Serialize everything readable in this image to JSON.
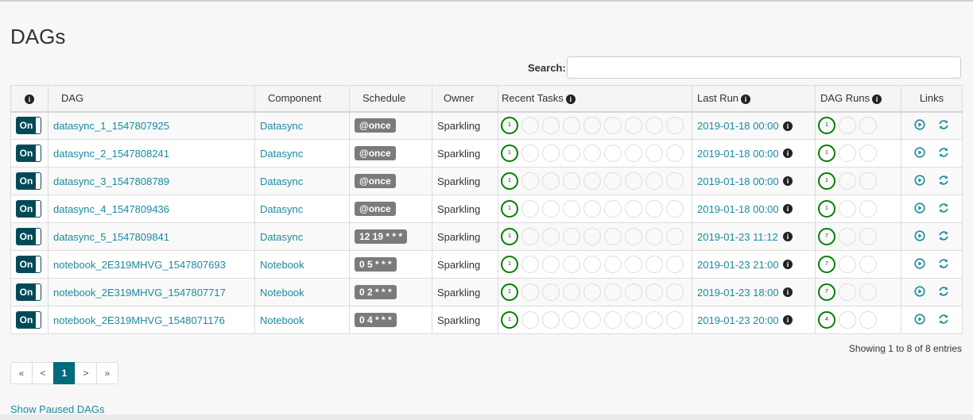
{
  "page": {
    "title": "DAGs",
    "search_label": "Search:",
    "search_value": "",
    "entries_text": "Showing 1 to 8 of 8 entries",
    "show_paused": "Show Paused DAGs"
  },
  "columns": {
    "info": "i",
    "dag": "DAG",
    "component": "Component",
    "schedule": "Schedule",
    "owner": "Owner",
    "recent_tasks": "Recent Tasks",
    "last_run": "Last Run",
    "dag_runs": "DAG Runs",
    "links": "Links"
  },
  "colors": {
    "link": "#1a8b9f",
    "toggle": "#004a57",
    "success": "#008000",
    "schedule_badge": "#7b7b7b",
    "active_page": "#006b7d"
  },
  "toggle_label": "On",
  "rows": [
    {
      "dag": "datasync_1_1547807925",
      "component": "Datasync",
      "schedule": "@once",
      "owner": "Sparkling",
      "recent_success": "1",
      "last_run": "2019-01-18 00:00",
      "dag_runs_success": "1"
    },
    {
      "dag": "datasync_2_1547808241",
      "component": "Datasync",
      "schedule": "@once",
      "owner": "Sparkling",
      "recent_success": "1",
      "last_run": "2019-01-18 00:00",
      "dag_runs_success": "1"
    },
    {
      "dag": "datasync_3_1547808789",
      "component": "Datasync",
      "schedule": "@once",
      "owner": "Sparkling",
      "recent_success": "1",
      "last_run": "2019-01-18 00:00",
      "dag_runs_success": "1"
    },
    {
      "dag": "datasync_4_1547809436",
      "component": "Datasync",
      "schedule": "@once",
      "owner": "Sparkling",
      "recent_success": "1",
      "last_run": "2019-01-18 00:00",
      "dag_runs_success": "1"
    },
    {
      "dag": "datasync_5_1547809841",
      "component": "Datasync",
      "schedule": "12 19 * * *",
      "owner": "Sparkling",
      "recent_success": "1",
      "last_run": "2019-01-23 11:12",
      "dag_runs_success": "7"
    },
    {
      "dag": "notebook_2E319MHVG_1547807693",
      "component": "Notebook",
      "schedule": "0 5 * * *",
      "owner": "Sparkling",
      "recent_success": "1",
      "last_run": "2019-01-23 21:00",
      "dag_runs_success": "7"
    },
    {
      "dag": "notebook_2E319MHVG_1547807717",
      "component": "Notebook",
      "schedule": "0 2 * * *",
      "owner": "Sparkling",
      "recent_success": "1",
      "last_run": "2019-01-23 18:00",
      "dag_runs_success": "7"
    },
    {
      "dag": "notebook_2E319MHVG_1548071176",
      "component": "Notebook",
      "schedule": "0 4 * * *",
      "owner": "Sparkling",
      "recent_success": "1",
      "last_run": "2019-01-23 20:00",
      "dag_runs_success": "4"
    }
  ],
  "icons": {
    "info": "info-circle-icon",
    "trigger": "play-circle-icon",
    "refresh": "refresh-icon"
  },
  "pagination": {
    "first": "«",
    "prev": "<",
    "current": "1",
    "next": ">",
    "last": "»"
  }
}
